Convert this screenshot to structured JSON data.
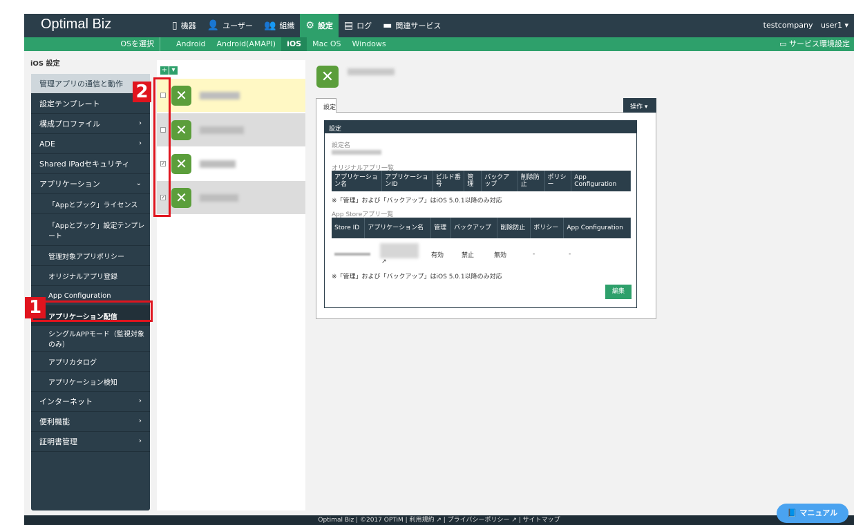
{
  "header": {
    "brand": "Optimal Biz",
    "nav": [
      {
        "icon": "phone-icon",
        "glyph": "▯",
        "label": "機器",
        "active": false
      },
      {
        "icon": "user-icon",
        "glyph": "👤",
        "label": "ユーザー",
        "active": false
      },
      {
        "icon": "group-icon",
        "glyph": "👥",
        "label": "組織",
        "active": false
      },
      {
        "icon": "gear-icon",
        "glyph": "⚙",
        "label": "設定",
        "active": true
      },
      {
        "icon": "log-icon",
        "glyph": "▤",
        "label": "ログ",
        "active": false
      },
      {
        "icon": "folder-icon",
        "glyph": "▬",
        "label": "関連サービス",
        "active": false
      }
    ],
    "company": "testcompany",
    "user": "user1 ▾"
  },
  "subheader": {
    "os_select": "OSを選択",
    "tabs": [
      {
        "label": "Android",
        "active": false
      },
      {
        "label": "Android(AMAPI)",
        "active": false
      },
      {
        "label": "iOS",
        "active": true
      },
      {
        "label": "Mac OS",
        "active": false
      },
      {
        "label": "Windows",
        "active": false
      }
    ],
    "service_settings": "▭ サービス環境設定"
  },
  "page_title": "iOS 設定",
  "sidebar": {
    "items": [
      {
        "label": "管理アプリの通信と動作",
        "chevron": "",
        "kind": "top"
      },
      {
        "label": "設定テンプレート",
        "chevron": "",
        "kind": "top"
      },
      {
        "label": "構成プロファイル",
        "chevron": "›",
        "kind": "top"
      },
      {
        "label": "ADE",
        "chevron": "›",
        "kind": "top"
      },
      {
        "label": "Shared iPadセキュリティ",
        "chevron": "",
        "kind": "top"
      },
      {
        "label": "アプリケーション",
        "chevron": "⌄",
        "kind": "top"
      },
      {
        "label": "「Appとブック」ライセンス",
        "kind": "sub"
      },
      {
        "label": "「Appとブック」設定テンプレート",
        "kind": "sub"
      },
      {
        "label": "管理対象アプリポリシー",
        "kind": "sub"
      },
      {
        "label": "オリジナルアプリ登録",
        "kind": "sub"
      },
      {
        "label": "App Configuration",
        "kind": "sub"
      },
      {
        "label": "アプリケーション配信",
        "kind": "sub",
        "active": true
      },
      {
        "label": "シングルAPPモード（監視対象のみ）",
        "kind": "sub"
      },
      {
        "label": "アプリカタログ",
        "kind": "sub"
      },
      {
        "label": "アプリケーション検知",
        "kind": "sub"
      },
      {
        "label": "インターネット",
        "chevron": "›",
        "kind": "top"
      },
      {
        "label": "便利機能",
        "chevron": "›",
        "kind": "top"
      },
      {
        "label": "証明書管理",
        "chevron": "›",
        "kind": "top"
      }
    ]
  },
  "list": {
    "add_label": "+",
    "dropdown_label": "▾",
    "rows": [
      {
        "checked": false,
        "highlight": "#fff8c4"
      },
      {
        "checked": false,
        "highlight": "#dcdcdc"
      },
      {
        "checked": true,
        "highlight": "#ffffff"
      },
      {
        "checked": true,
        "highlight": "#dcdcdc"
      }
    ]
  },
  "detail": {
    "tab_label": "設定",
    "ops_label": "操作 ▾",
    "card_title": "設定",
    "setting_name_label": "設定名",
    "original_apps_label": "オリジナルアプリ一覧",
    "original_table_headers": [
      "アプリケーション名",
      "アプリケーションID",
      "ビルド番号",
      "管理",
      "バックアップ",
      "削除防止",
      "ポリシー",
      "App Configuration"
    ],
    "note1": "※「管理」および「バックアップ」はiOS 5.0.1以降のみ対応",
    "store_apps_label": "App Storeアプリ一覧",
    "store_table_headers": [
      "Store ID",
      "アプリケーション名",
      "管理",
      "バックアップ",
      "削除防止",
      "ポリシー",
      "App Configuration"
    ],
    "store_row": {
      "manage": "有効",
      "backup": "禁止",
      "delete_protect": "無効",
      "policy": "-",
      "app_config": "-"
    },
    "note2": "※「管理」および「バックアップ」はiOS 5.0.1以降のみ対応",
    "edit_label": "編集"
  },
  "footer": {
    "text": "Optimal Biz | ©2017 OPTiM | 利用規約 ↗ | プライバシーポリシー ↗ | サイトマップ"
  },
  "manual_label": "📘 マニュアル",
  "annotations": {
    "one": "1",
    "two": "2"
  },
  "colors": {
    "nav_dark": "#2b3e4a",
    "accent_green": "#2ea06b",
    "annotation_red": "#e0141e"
  }
}
